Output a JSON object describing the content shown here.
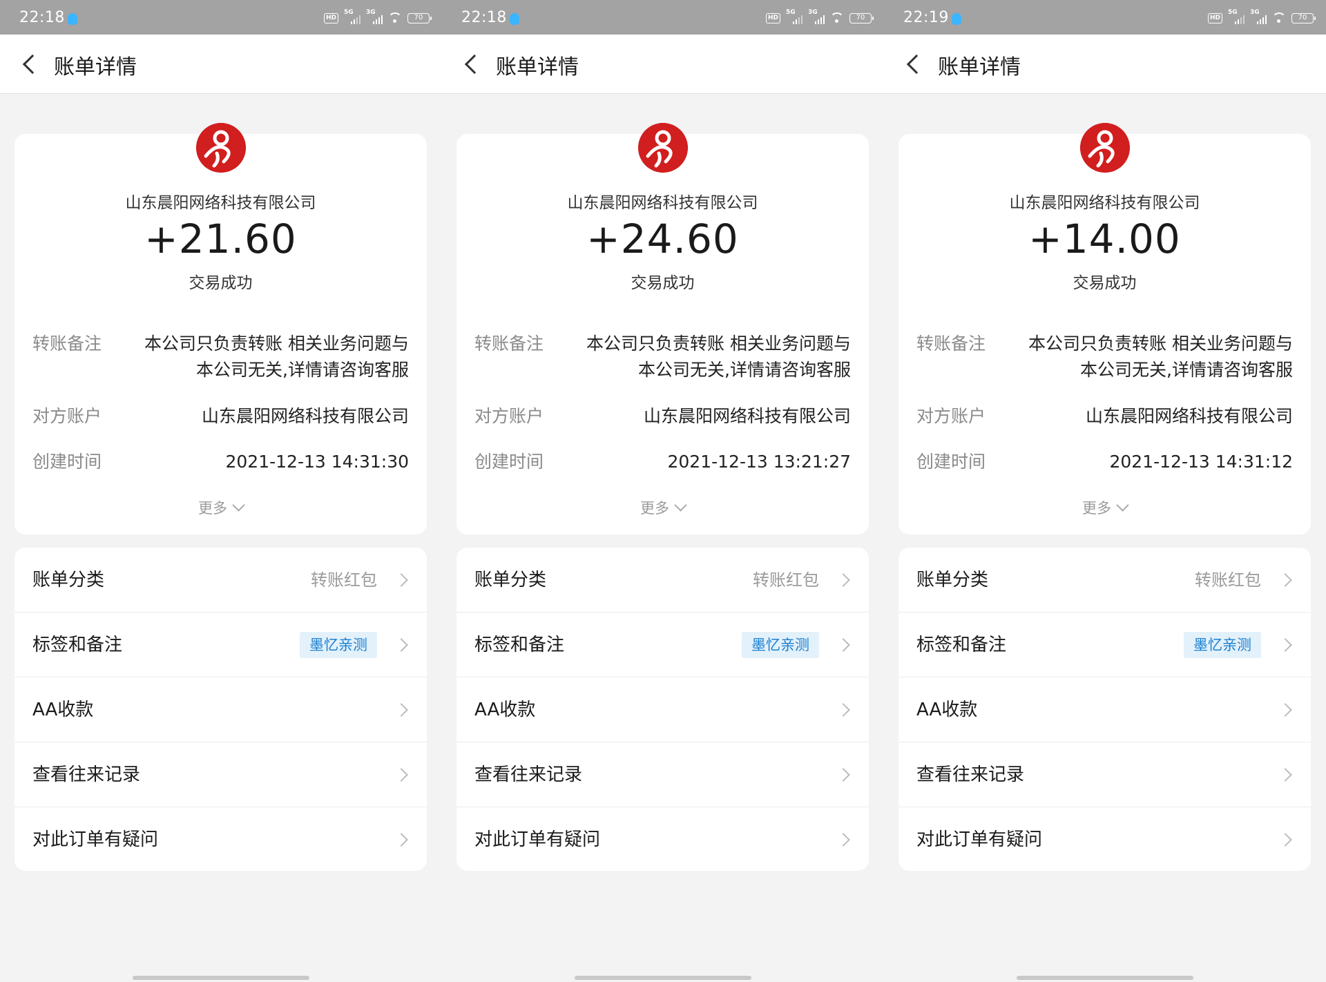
{
  "app": {
    "title": "账单详情",
    "labels": {
      "remark": "转账备注",
      "counterparty": "对方账户",
      "created": "创建时间",
      "more": "更多"
    },
    "options": {
      "category": "账单分类",
      "category_value": "转账红包",
      "tags": "标签和备注",
      "tag_value": "墨忆亲测",
      "aa": "AA收款",
      "history": "查看往来记录",
      "question": "对此订单有疑问"
    }
  },
  "screens": [
    {
      "time": "22:18",
      "battery": "70",
      "merchant": "山东晨阳网络科技有限公司",
      "amount": "+21.60",
      "status": "交易成功",
      "remark_line1": "本公司只负责转账 相关业务问题与",
      "remark_line2": "本公司无关,详情请咨询客服",
      "counterparty": "山东晨阳网络科技有限公司",
      "created_time": "2021-12-13 14:31:30"
    },
    {
      "time": "22:18",
      "battery": "70",
      "merchant": "山东晨阳网络科技有限公司",
      "amount": "+24.60",
      "status": "交易成功",
      "remark_line1": "本公司只负责转账 相关业务问题与",
      "remark_line2": "本公司无关,详情请咨询客服",
      "counterparty": "山东晨阳网络科技有限公司",
      "created_time": "2021-12-13 13:21:27"
    },
    {
      "time": "22:19",
      "battery": "70",
      "merchant": "山东晨阳网络科技有限公司",
      "amount": "+14.00",
      "status": "交易成功",
      "remark_line1": "本公司只负责转账 相关业务问题与",
      "remark_line2": "本公司无关,详情请咨询客服",
      "counterparty": "山东晨阳网络科技有限公司",
      "created_time": "2021-12-13 14:31:12"
    }
  ],
  "status_bar": {
    "hd": "HD",
    "sig1": "5G",
    "sig2": "3G"
  },
  "colors": {
    "background": "#f3f3f3",
    "status_bar": "#a3a3a3",
    "tag_bg": "#e3f1fb",
    "tag_text": "#1a7fd0",
    "logo_red": "#d11e1e"
  },
  "icons": [
    "qq-icon",
    "hd-icon",
    "signal-icon",
    "wifi-icon",
    "battery-icon",
    "back-icon",
    "merchant-logo-icon",
    "chevron-down-icon",
    "chevron-right-icon"
  ]
}
